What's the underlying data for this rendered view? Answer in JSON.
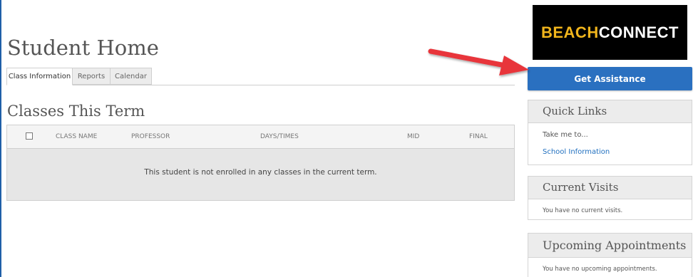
{
  "page": {
    "title": "Student Home"
  },
  "tabs": [
    {
      "label": "Class Information",
      "active": true
    },
    {
      "label": "Reports",
      "active": false
    },
    {
      "label": "Calendar",
      "active": false
    }
  ],
  "classes": {
    "title": "Classes This Term",
    "columns": [
      "CLASS NAME",
      "PROFESSOR",
      "DAYS/TIMES",
      "MID",
      "FINAL"
    ],
    "empty_message": "This student is not enrolled in any classes in the current term."
  },
  "logo": {
    "part1": "BEACH",
    "part2": "CONNECT"
  },
  "assist_button": {
    "label": "Get Assistance"
  },
  "quick_links": {
    "title": "Quick Links",
    "subtitle": "Take me to...",
    "links": [
      "School Information"
    ]
  },
  "current_visits": {
    "title": "Current Visits",
    "message": "You have no current visits."
  },
  "upcoming_appointments": {
    "title": "Upcoming Appointments",
    "message": "You have no upcoming appointments."
  },
  "colors": {
    "primary_button": "#2a70c0",
    "logo_accent": "#f1b51c",
    "link": "#1f6fbf",
    "arrow": "#e8343a"
  }
}
